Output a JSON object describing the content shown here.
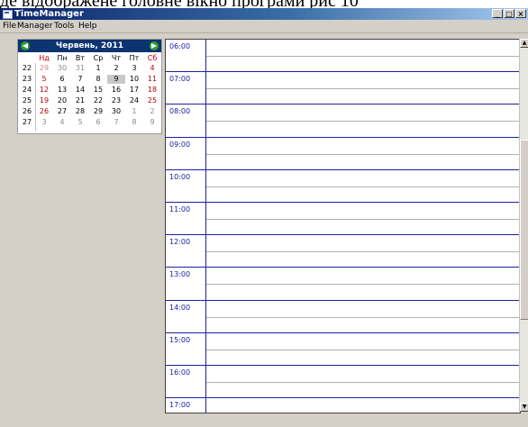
{
  "caption_fragment": "де відображене головне вікно програми рис 10",
  "window": {
    "title": "TimeManager",
    "buttons": [
      "_",
      "□",
      "×"
    ]
  },
  "menu": [
    {
      "label": "File"
    },
    {
      "label": "Manager"
    },
    {
      "label": "Tools"
    },
    {
      "label": "Help"
    }
  ],
  "calendar": {
    "month_year": "Червень, 2011",
    "prev_icon": "left-arrow",
    "next_icon": "right-arrow",
    "weekdays": [
      "Нд",
      "Пн",
      "Вт",
      "Ср",
      "Чт",
      "Пт",
      "Сб"
    ],
    "weeks": [
      {
        "week": "22",
        "days": [
          "29",
          "30",
          "31",
          "1",
          "2",
          "3",
          "4"
        ]
      },
      {
        "week": "23",
        "days": [
          "5",
          "6",
          "7",
          "8",
          "9",
          "10",
          "11"
        ]
      },
      {
        "week": "24",
        "days": [
          "12",
          "13",
          "14",
          "15",
          "16",
          "17",
          "18"
        ]
      },
      {
        "week": "25",
        "days": [
          "19",
          "20",
          "21",
          "22",
          "23",
          "24",
          "25"
        ]
      },
      {
        "week": "26",
        "days": [
          "26",
          "27",
          "28",
          "29",
          "30",
          "1",
          "2"
        ]
      },
      {
        "week": "27",
        "days": [
          "3",
          "4",
          "5",
          "6",
          "7",
          "8",
          "9"
        ]
      }
    ],
    "selected_day": "9"
  },
  "schedule": {
    "times": [
      "06:00",
      "07:00",
      "08:00",
      "09:00",
      "10:00",
      "11:00",
      "12:00",
      "13:00",
      "14:00",
      "15:00",
      "16:00",
      "17:00"
    ]
  },
  "colors": {
    "calendar_header": "#0c3470",
    "time_text": "#1a1aa0",
    "weekend": "#c00000"
  }
}
